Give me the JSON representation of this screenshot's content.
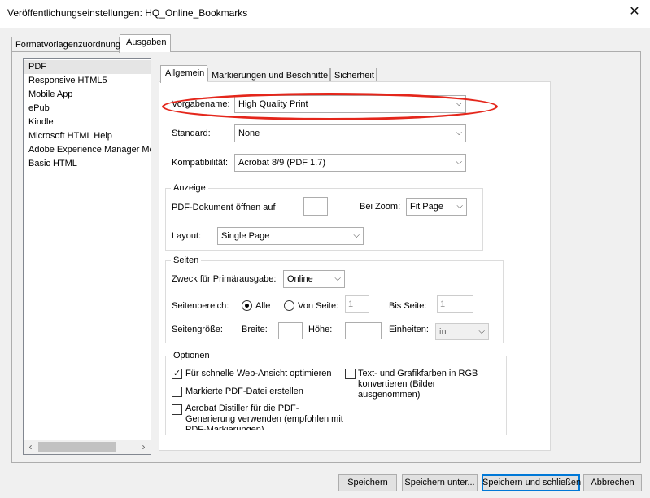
{
  "window": {
    "title": "Veröffentlichungseinstellungen: HQ_Online_Bookmarks",
    "close_glyph": "✕"
  },
  "outer_tabs": [
    {
      "label": "Formatvorlagenzuordnung",
      "active": false
    },
    {
      "label": "Ausgaben",
      "active": true
    }
  ],
  "output_list": {
    "items": [
      "PDF",
      "Responsive HTML5",
      "Mobile App",
      "ePub",
      "Kindle",
      "Microsoft HTML Help",
      "Adobe Experience Manager Mo",
      "Basic HTML"
    ],
    "selected": "PDF",
    "scroll_left_glyph": "‹",
    "scroll_right_glyph": "›"
  },
  "inner_tabs": [
    {
      "label": "Allgemein",
      "active": true
    },
    {
      "label": "Markierungen und Beschnitte",
      "active": false
    },
    {
      "label": "Sicherheit",
      "active": false
    }
  ],
  "general": {
    "preset_label": "Vorgabename:",
    "preset_value": "High Quality Print",
    "standard_label": "Standard:",
    "standard_value": "None",
    "compat_label": "Kompatibilität:",
    "compat_value": "Acrobat 8/9 (PDF 1.7)"
  },
  "display": {
    "group_label": "Anzeige",
    "open_label": "PDF-Dokument öffnen auf",
    "open_value": "",
    "zoom_label": "Bei Zoom:",
    "zoom_value": "Fit Page",
    "layout_label": "Layout:",
    "layout_value": "Single Page"
  },
  "pages": {
    "group_label": "Seiten",
    "purpose_label": "Zweck für Primärausgabe:",
    "purpose_value": "Online",
    "range_label": "Seitenbereich:",
    "all_label": "Alle",
    "from_label": "Von Seite:",
    "from_value": "1",
    "to_label": "Bis Seite:",
    "to_value": "1",
    "size_label": "Seitengröße:",
    "width_label": "Breite:",
    "height_label": "Höhe:",
    "units_label": "Einheiten:",
    "units_value": "in",
    "range_selected": "Alle"
  },
  "options": {
    "group_label": "Optionen",
    "fast_web": {
      "label": "Für schnelle Web-Ansicht optimieren",
      "checked": true
    },
    "tagged_pdf": {
      "label": "Markierte PDF-Datei erstellen",
      "checked": false
    },
    "distiller": {
      "label": "Acrobat Distiller für die PDF-Generierung verwenden (empfohlen mit PDF-Markierungen)",
      "checked": false
    },
    "rgb": {
      "label": "Text- und Grafikfarben in RGB konvertieren (Bilder ausgenommen)",
      "checked": false
    },
    "check_glyph": "✓"
  },
  "buttons": {
    "save": "Speichern",
    "save_as": "Speichern unter...",
    "save_close": "Speichern und schließen",
    "cancel": "Abbrechen"
  },
  "icons": {
    "dropdown_arrow": "chevron-down-icon",
    "arrow_glyph": "⌵"
  },
  "colors": {
    "highlight_ellipse": "#e4261b",
    "default_button_border": "#0078d7"
  }
}
